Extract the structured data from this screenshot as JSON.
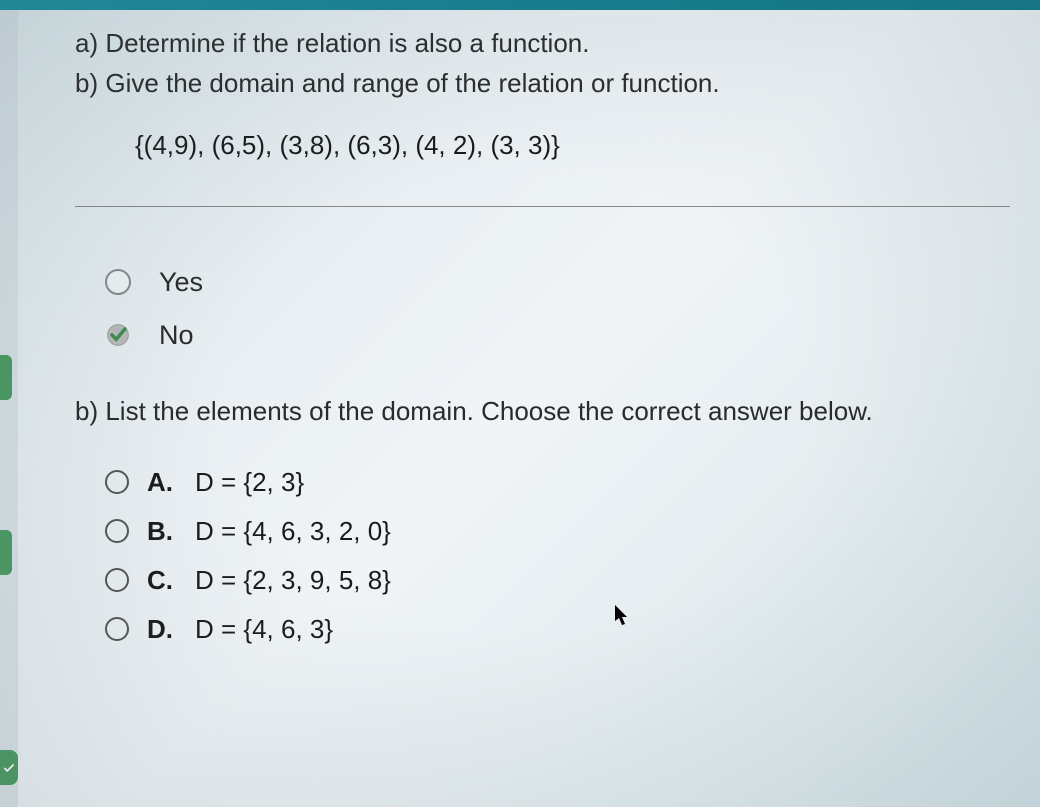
{
  "question": {
    "part_a": "a) Determine if the relation is also a function.",
    "part_b": "b) Give the domain and range of the relation or function.",
    "relation_set": "{(4,9), (6,5), (3,8), (6,3), (4, 2), (3, 3)}"
  },
  "part_a_options": {
    "yes": "Yes",
    "no": "No",
    "selected": "no"
  },
  "part_b_prompt": "b) List the elements of the domain. Choose the correct answer below.",
  "part_b_options": [
    {
      "letter": "A.",
      "text": "D = {2, 3}"
    },
    {
      "letter": "B.",
      "text": "D = {4, 6, 3, 2, 0}"
    },
    {
      "letter": "C.",
      "text": "D = {2, 3, 9, 5, 8}"
    },
    {
      "letter": "D.",
      "text": "D = {4, 6, 3}"
    }
  ]
}
